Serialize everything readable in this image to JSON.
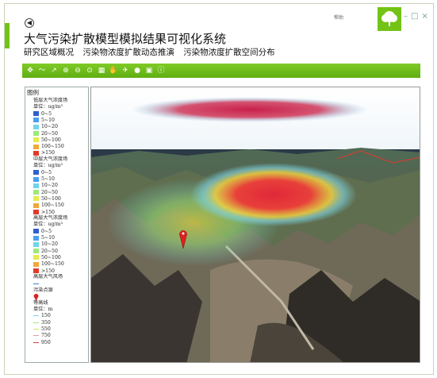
{
  "window": {
    "help_label": "帮助",
    "title": "大气污染扩散模型模拟结果可视化系统"
  },
  "nav": {
    "items": [
      "研究区域概况",
      "污染物浓度扩散动态推演",
      "污染物浓度扩散空间分布"
    ]
  },
  "toolbar": {
    "icons": [
      "pan-icon",
      "measure-icon",
      "select-icon",
      "zoom-in-icon",
      "zoom-out-icon",
      "full-extent-icon",
      "layer-icon",
      "hand-icon",
      "fly-icon",
      "globe-icon",
      "screenshot-icon",
      "info-icon"
    ]
  },
  "legend": {
    "title": "图例",
    "groups": [
      {
        "name": "低层大气浓度场",
        "unit": "单位：ug/m³",
        "classes": [
          {
            "label": "0~5",
            "color": "#2f5fd0"
          },
          {
            "label": "5~10",
            "color": "#4a9ff0"
          },
          {
            "label": "10~20",
            "color": "#6fd6e6"
          },
          {
            "label": "20~50",
            "color": "#9ee87a"
          },
          {
            "label": "50~100",
            "color": "#e6ec4a"
          },
          {
            "label": "100~150",
            "color": "#f1a83a"
          },
          {
            "label": ">150",
            "color": "#e23a2a"
          }
        ]
      },
      {
        "name": "中层大气浓度场",
        "unit": "单位：ug/m³",
        "classes": [
          {
            "label": "0~5",
            "color": "#2f5fd0"
          },
          {
            "label": "5~10",
            "color": "#4a9ff0"
          },
          {
            "label": "10~20",
            "color": "#6fd6e6"
          },
          {
            "label": "20~50",
            "color": "#9ee87a"
          },
          {
            "label": "50~100",
            "color": "#e6ec4a"
          },
          {
            "label": "100~150",
            "color": "#f1a83a"
          },
          {
            "label": ">150",
            "color": "#e23a2a"
          }
        ]
      },
      {
        "name": "高层大气浓度场",
        "unit": "单位：ug/m³",
        "classes": [
          {
            "label": "0~5",
            "color": "#2f5fd0"
          },
          {
            "label": "5~10",
            "color": "#4a9ff0"
          },
          {
            "label": "10~20",
            "color": "#6fd6e6"
          },
          {
            "label": "20~50",
            "color": "#9ee87a"
          },
          {
            "label": "50~100",
            "color": "#e6ec4a"
          },
          {
            "label": "100~150",
            "color": "#f1a83a"
          },
          {
            "label": ">150",
            "color": "#e23a2a"
          }
        ]
      }
    ],
    "wind_label": "高层大气风场",
    "source_label": "污染点源",
    "contour": {
      "name": "等高线",
      "unit": "单位：m",
      "classes": [
        {
          "label": "150",
          "color": "#7fd0e0"
        },
        {
          "label": "350",
          "color": "#9ee87a"
        },
        {
          "label": "550",
          "color": "#c8e860"
        },
        {
          "label": "750",
          "color": "#e69a9a"
        },
        {
          "label": "950",
          "color": "#d04040"
        }
      ]
    }
  }
}
